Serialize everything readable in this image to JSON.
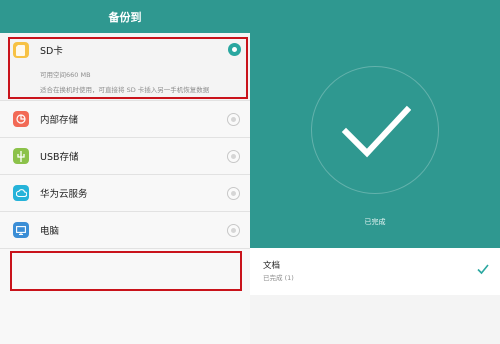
{
  "left_panel": {
    "title": "备份到",
    "items": [
      {
        "label": "SD卡",
        "info": "可用空间660 MB",
        "note": "适合在换机时使用，可直接将 SD 卡插入另一手机恢复数据",
        "selected": true,
        "icon": "sd-card-icon",
        "color": "#f7c244"
      },
      {
        "label": "内部存储",
        "selected": false,
        "icon": "pie-chart-icon",
        "color": "#f26a56"
      },
      {
        "label": "USB存储",
        "selected": false,
        "icon": "usb-icon",
        "color": "#8cc24a"
      },
      {
        "label": "华为云服务",
        "selected": false,
        "icon": "cloud-icon",
        "color": "#26b3d9"
      },
      {
        "label": "电脑",
        "selected": false,
        "icon": "monitor-icon",
        "color": "#3b8ed6"
      }
    ]
  },
  "right_panel": {
    "status": "已完成",
    "file": {
      "name": "文档",
      "status": "已完成 (1)"
    }
  },
  "colors": {
    "accent": "#2f9890",
    "highlight": "#c9131b"
  }
}
